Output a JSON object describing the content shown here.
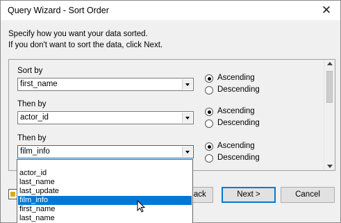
{
  "window": {
    "title": "Query Wizard - Sort Order",
    "close_glyph": "✕"
  },
  "intro": {
    "line1": "Specify how you want your data sorted.",
    "line2": "If you don't want to sort the data, click Next."
  },
  "sort_rows": [
    {
      "label": "Sort by",
      "value": "first_name",
      "ascending": "Ascending",
      "descending": "Descending",
      "selected": "Ascending"
    },
    {
      "label": "Then by",
      "value": "actor_id",
      "ascending": "Ascending",
      "descending": "Descending",
      "selected": "Ascending"
    },
    {
      "label": "Then by",
      "value": "film_info",
      "ascending": "Ascending",
      "descending": "Descending",
      "selected": "Ascending"
    }
  ],
  "dropdown": {
    "items": [
      "",
      "actor_id",
      "last_name",
      "last_update",
      "film_info",
      "first_name",
      "last_name"
    ],
    "selected_index": 4
  },
  "buttons": {
    "back": "< Back",
    "back_visible": "Back",
    "next": "Next >",
    "cancel": "Cancel"
  },
  "colors": {
    "accent": "#0078d7",
    "window_bg": "#f0f0f0"
  }
}
